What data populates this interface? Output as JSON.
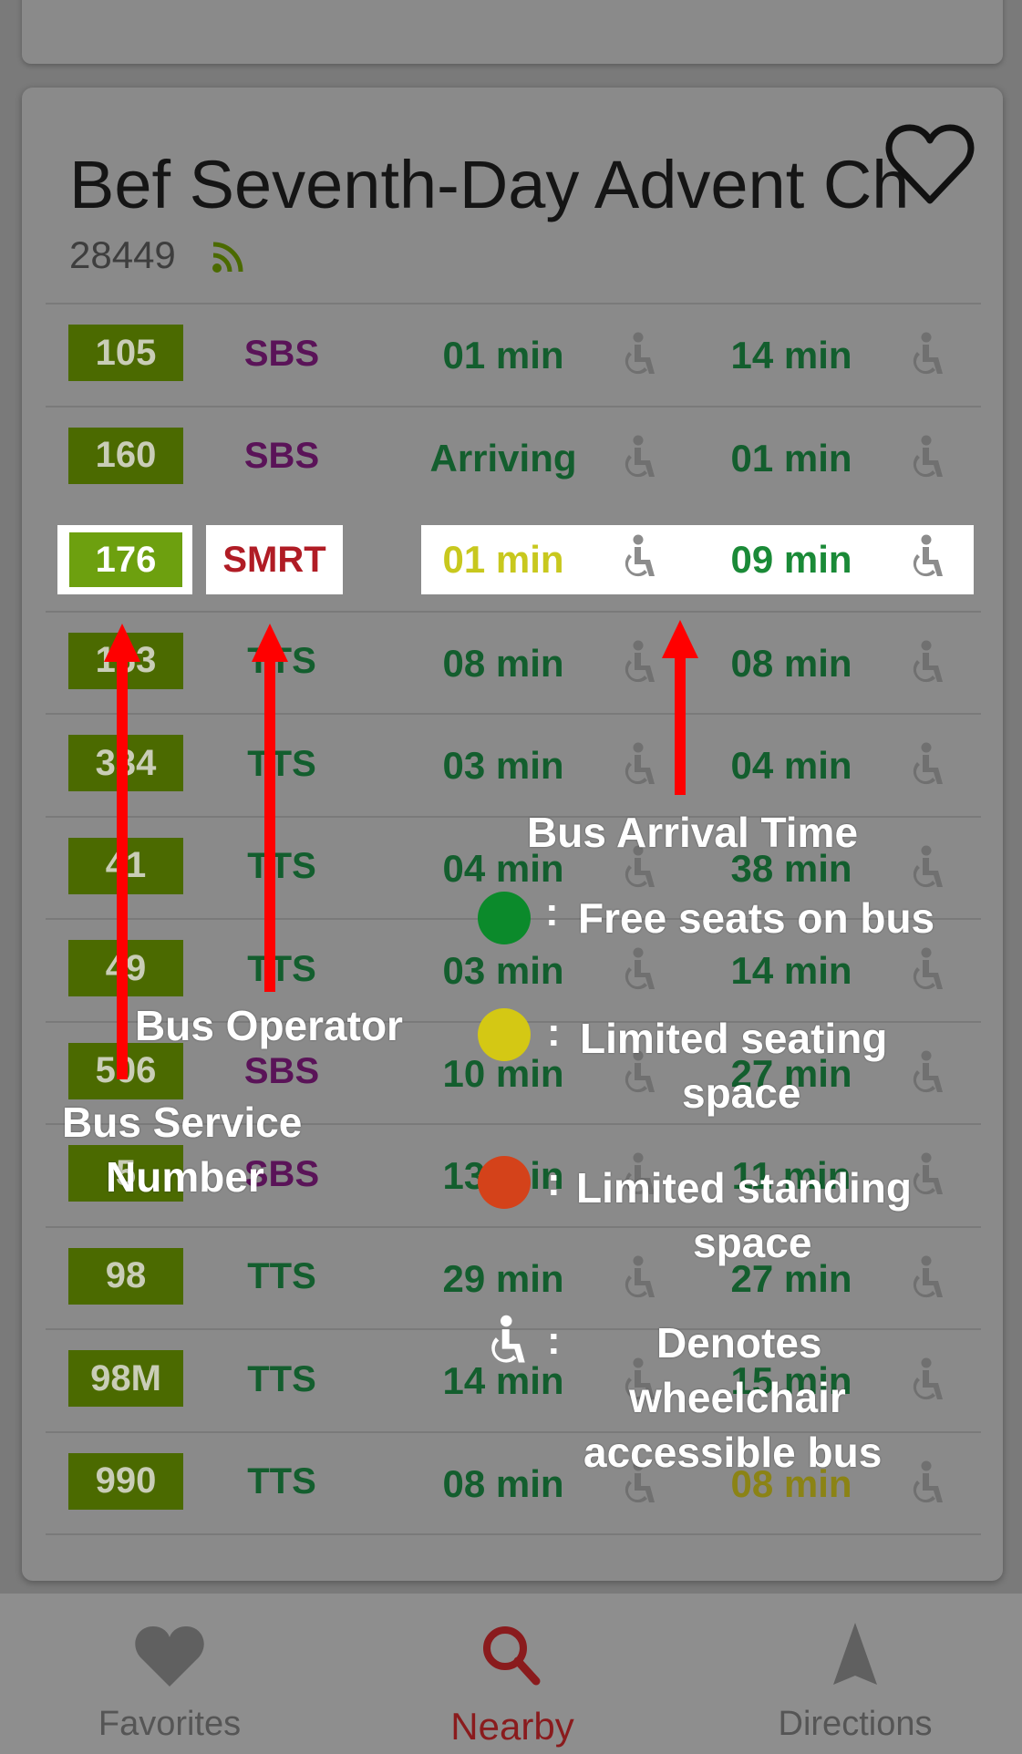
{
  "stop": {
    "name": "Bef Seventh-Day Advent Ch",
    "code": "28449",
    "favorite_icon": "heart-outline-icon",
    "live_icon": "rss-icon"
  },
  "rows": [
    {
      "service": "105",
      "operator": "SBS",
      "time1": "01 min",
      "time2": "14 min",
      "op_class": "sbs"
    },
    {
      "service": "160",
      "operator": "SBS",
      "time1": "Arriving",
      "time2": "01 min",
      "op_class": "sbs"
    },
    {
      "service": "176",
      "operator": "SMRT",
      "time1": "01 min",
      "time2": "09 min",
      "op_class": "smrt",
      "highlighted": true
    },
    {
      "service": "163",
      "operator": "TTS",
      "time1": "08 min",
      "time2": "08 min",
      "op_class": "tts"
    },
    {
      "service": "334",
      "operator": "TTS",
      "time1": "03 min",
      "time2": "04 min",
      "op_class": "tts"
    },
    {
      "service": "41",
      "operator": "TTS",
      "time1": "04 min",
      "time2": "38 min",
      "op_class": "tts"
    },
    {
      "service": "49",
      "operator": "TTS",
      "time1": "03 min",
      "time2": "14 min",
      "op_class": "tts"
    },
    {
      "service": "506",
      "operator": "SBS",
      "time1": "10 min",
      "time2": "27 min",
      "op_class": "sbs"
    },
    {
      "service": "5",
      "operator": "SBS",
      "time1": "13 min",
      "time2": "11 min",
      "op_class": "sbs"
    },
    {
      "service": "98",
      "operator": "TTS",
      "time1": "29 min",
      "time2": "27 min",
      "op_class": "tts"
    },
    {
      "service": "98M",
      "operator": "TTS",
      "time1": "14 min",
      "time2": "15 min",
      "op_class": "tts"
    },
    {
      "service": "990",
      "operator": "TTS",
      "time1": "08 min",
      "time2": "08 min",
      "op_class": "tts",
      "time2_color": "yellow"
    }
  ],
  "annotations": {
    "bus_service_number": [
      "Bus Service",
      "Number"
    ],
    "bus_operator": "Bus Operator",
    "bus_arrival_time": "Bus Arrival Time",
    "colon": ":",
    "legend": [
      {
        "color": "#0b8a2b",
        "text": [
          "Free seats on bus"
        ]
      },
      {
        "color": "#d4c814",
        "text": [
          "Limited seating",
          "space"
        ]
      },
      {
        "color": "#d4421a",
        "text": [
          "Limited standing",
          "space"
        ]
      },
      {
        "icon": "wheelchair-icon",
        "text": [
          "Denotes",
          "wheelchair",
          "accessible bus"
        ]
      }
    ]
  },
  "nav": {
    "items": [
      {
        "label": "Favorites",
        "icon": "heart-icon"
      },
      {
        "label": "Nearby",
        "icon": "search-icon",
        "active": true
      },
      {
        "label": "Directions",
        "icon": "navigation-arrow-icon"
      }
    ]
  },
  "colors": {
    "accent": "#8a1b1d",
    "service_bg": "#4b6a00",
    "arrow": "#ff0000"
  }
}
